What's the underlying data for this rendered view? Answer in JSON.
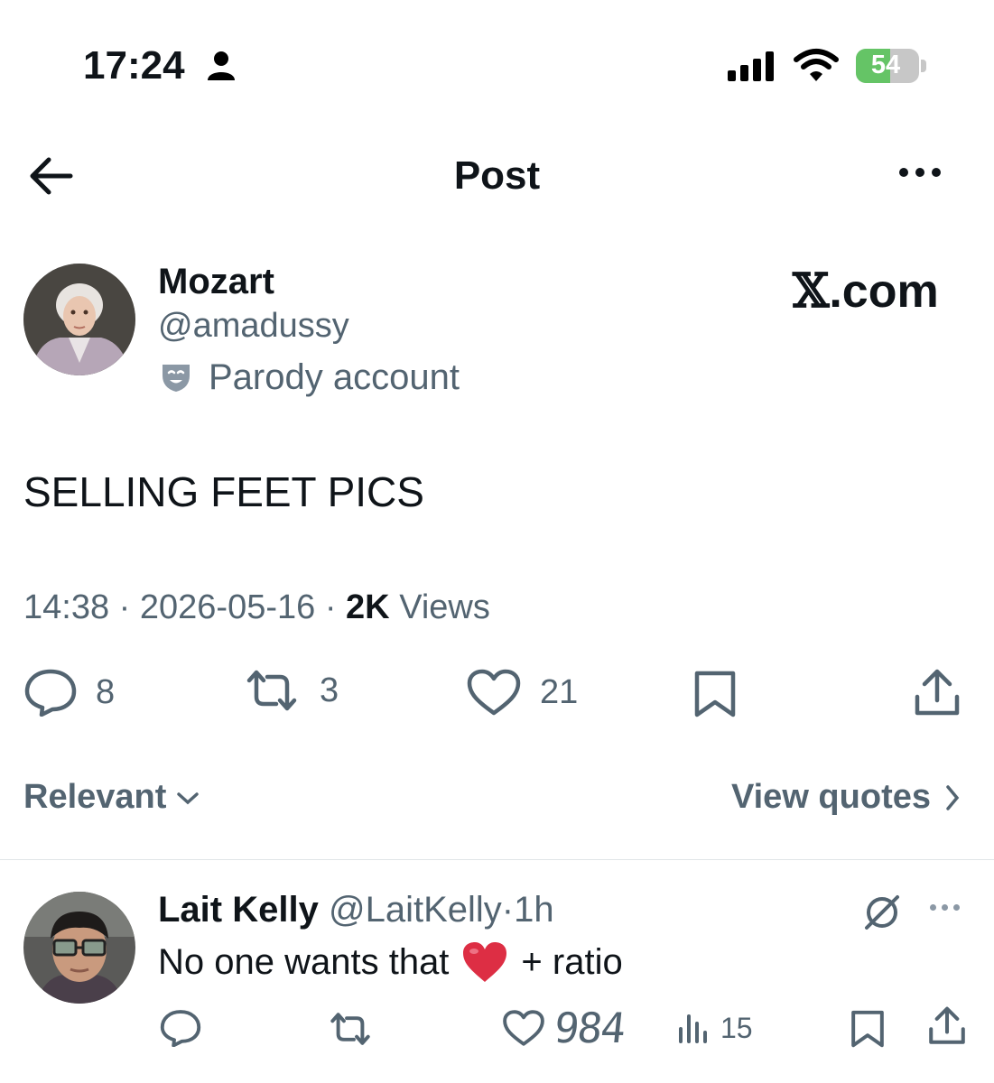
{
  "status_bar": {
    "time": "17:24",
    "battery": "54",
    "battery_level": 0.54
  },
  "header": {
    "title": "Post"
  },
  "author": {
    "name": "Mozart",
    "handle": "@amadussy",
    "label": "Parody account"
  },
  "watermark": {
    "prefix": "𝕏",
    "suffix": ".com"
  },
  "post": {
    "text": "SELLING FEET PICS",
    "time": "14:38",
    "date": "2026-05-16",
    "views_count": "2K",
    "views_label": "Views",
    "sep": "·"
  },
  "actions": {
    "replies": "8",
    "reposts": "3",
    "likes": "21"
  },
  "sort": {
    "label": "Relevant",
    "view_quotes": "View quotes"
  },
  "reply": {
    "name": "Lait Kelly",
    "handle": "@LaitKelly",
    "time": "1h",
    "text_before": "No one wants that",
    "emoji": "❤️",
    "text_after": "+ ratio",
    "likes": "984",
    "views": "15"
  },
  "colors": {
    "secondary": "#536471",
    "primary": "#0f1419",
    "battery_green": "#65c466"
  }
}
